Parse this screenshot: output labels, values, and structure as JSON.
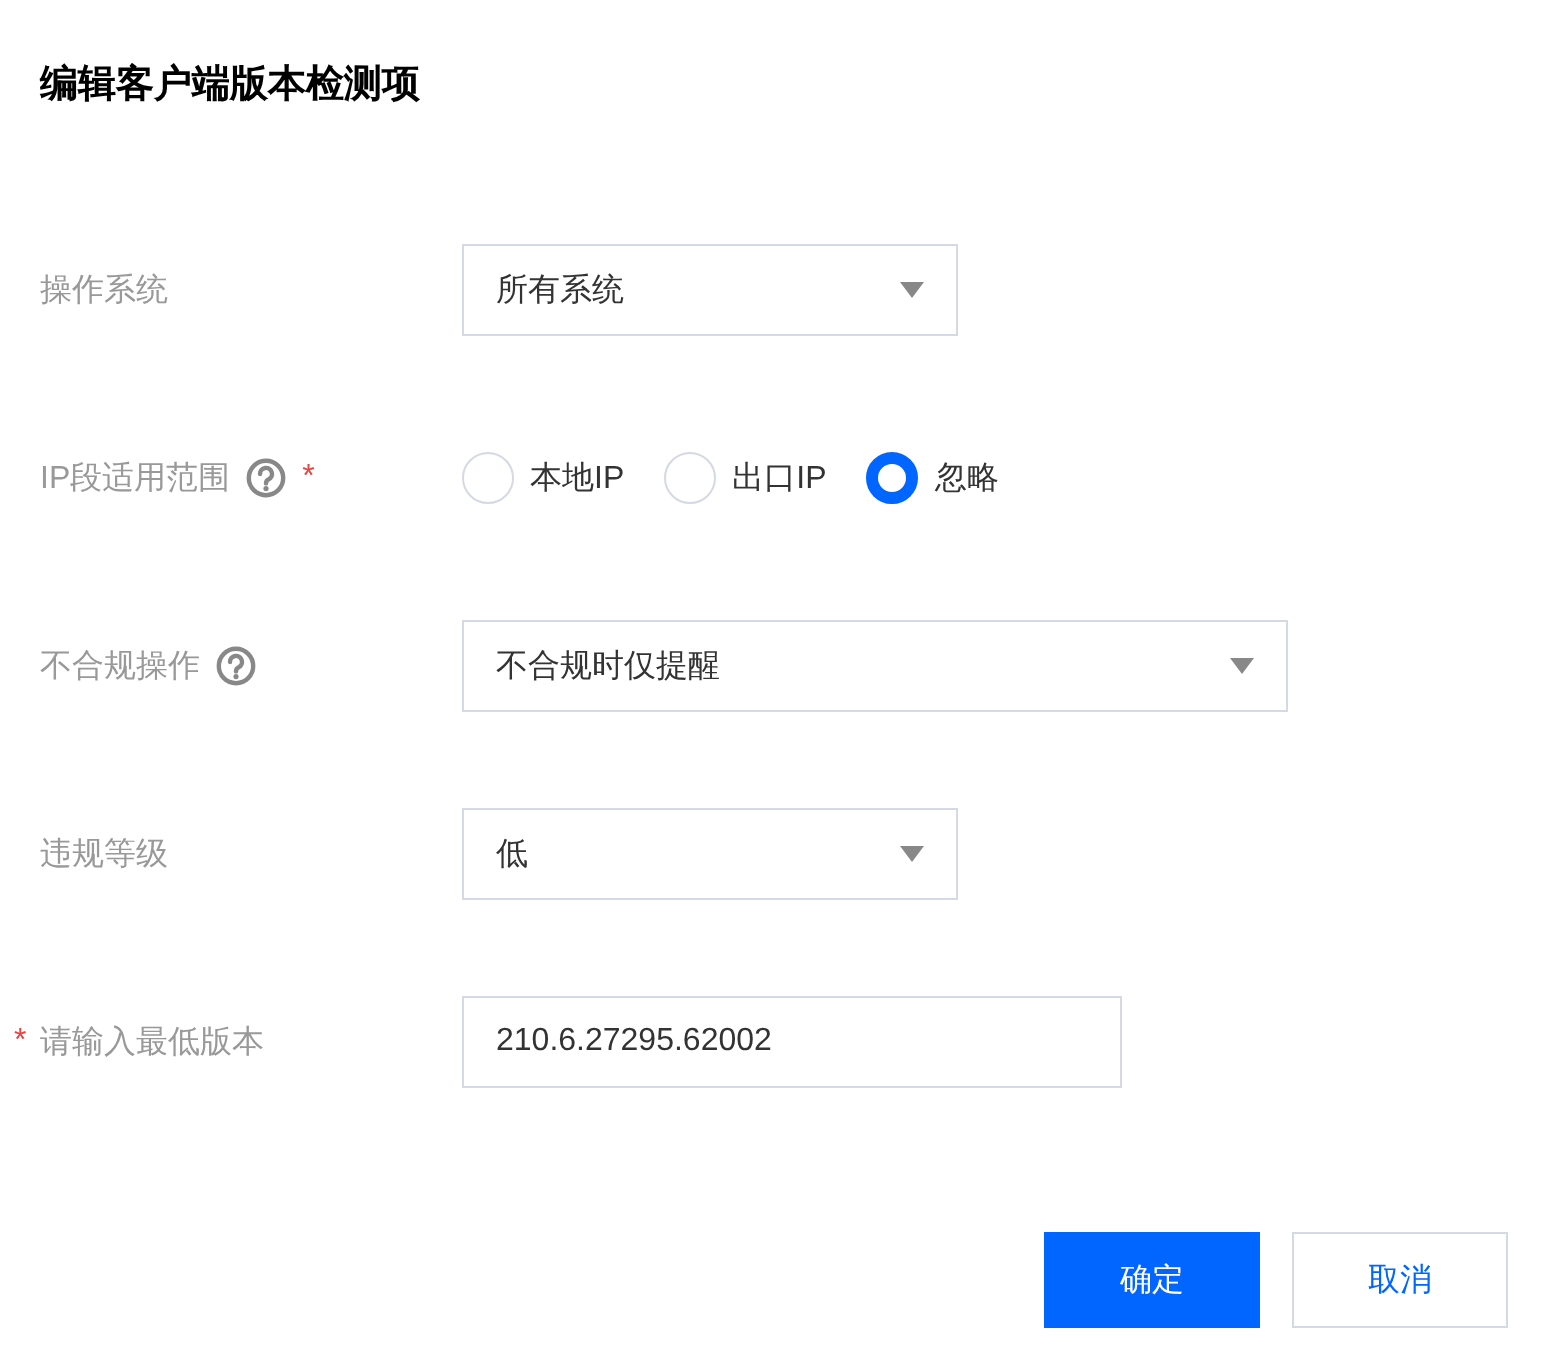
{
  "dialog": {
    "title": "编辑客户端版本检测项"
  },
  "fields": [
    {
      "kind": "select",
      "label": "操作系统",
      "help": false,
      "value": "所有系统"
    },
    {
      "kind": "radio",
      "label": "IP段适用范围",
      "help": true,
      "mark_after": "*",
      "options": [
        {
          "label": "本地IP",
          "selected": false
        },
        {
          "label": "出口IP",
          "selected": false
        },
        {
          "label": "忽略",
          "selected": true
        }
      ]
    },
    {
      "kind": "select",
      "label": "不合规操作",
      "help": true,
      "value": "不合规时仅提醒"
    },
    {
      "kind": "select",
      "label": "违规等级",
      "help": false,
      "value": "低"
    },
    {
      "kind": "input",
      "label": "请输入最低版本",
      "help": false,
      "mark_before": "*",
      "value": "210.6.27295.62002"
    }
  ],
  "buttons": [
    {
      "label": "确定",
      "kind": "primary"
    },
    {
      "label": "取消",
      "kind": "secondary"
    }
  ]
}
